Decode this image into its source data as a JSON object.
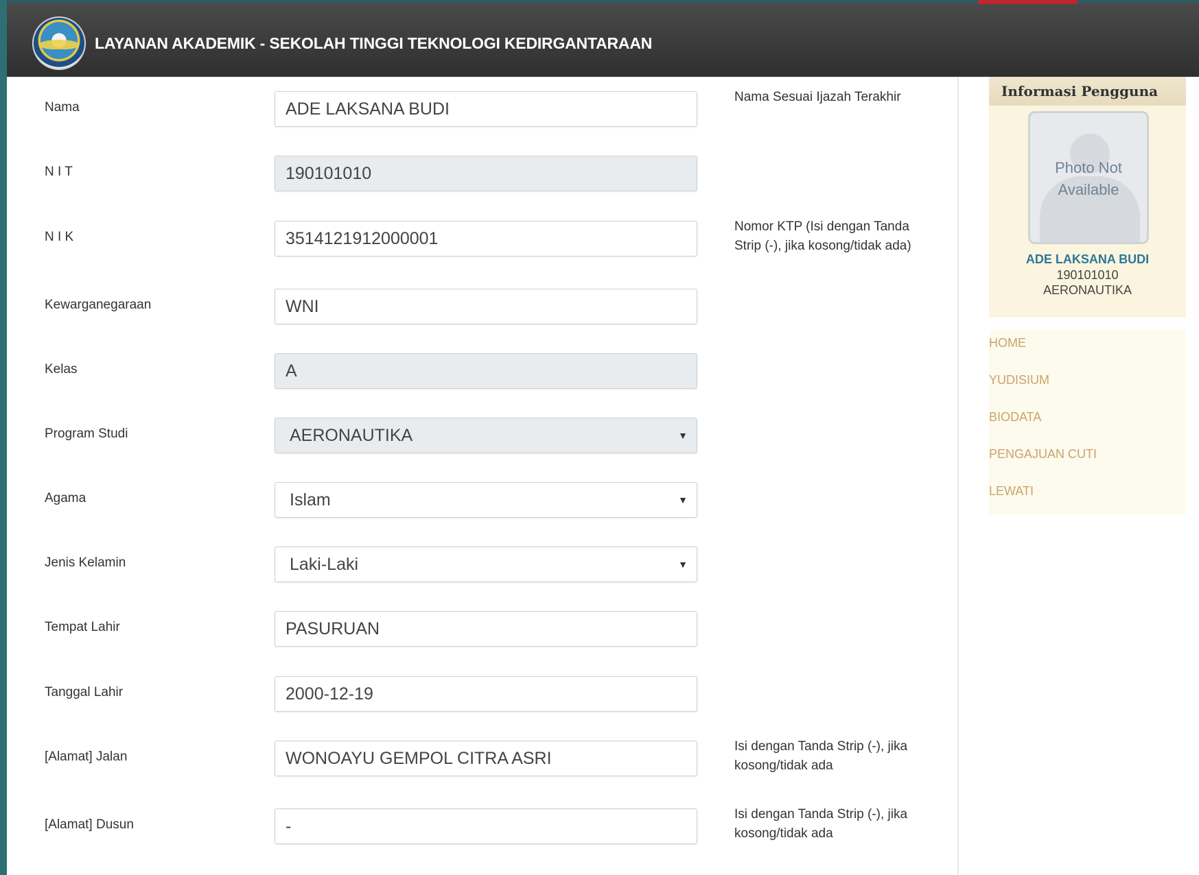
{
  "header": {
    "title": "LAYANAN AKADEMIK - SEKOLAH TINGGI TEKNOLOGI KEDIRGANTARAAN"
  },
  "form": {
    "nama": {
      "label": "Nama",
      "value": "ADE LAKSANA BUDI",
      "hint": "Nama Sesuai Ijazah Terakhir"
    },
    "nit": {
      "label": "N I T",
      "value": "190101010"
    },
    "nik": {
      "label": "N I K",
      "value": "3514121912000001",
      "hint": "Nomor KTP (Isi dengan Tanda Strip (-), jika kosong/tidak ada)"
    },
    "kewarganegaraan": {
      "label": "Kewarganegaraan",
      "value": "WNI"
    },
    "kelas": {
      "label": "Kelas",
      "value": "A"
    },
    "program_studi": {
      "label": "Program Studi",
      "value": "AERONAUTIKA"
    },
    "agama": {
      "label": "Agama",
      "value": "Islam"
    },
    "jenis_kelamin": {
      "label": "Jenis Kelamin",
      "value": "Laki-Laki"
    },
    "tempat_lahir": {
      "label": "Tempat Lahir",
      "value": "PASURUAN"
    },
    "tanggal_lahir": {
      "label": "Tanggal Lahir",
      "value": "2000-12-19"
    },
    "alamat_jalan": {
      "label": "[Alamat] Jalan",
      "value": "WONOAYU GEMPOL CITRA ASRI",
      "hint": "Isi dengan Tanda Strip (-), jika kosong/tidak ada"
    },
    "alamat_dusun": {
      "label": "[Alamat] Dusun",
      "value": "-",
      "hint": "Isi dengan Tanda Strip (-), jika kosong/tidak ada"
    }
  },
  "sidebar": {
    "title": "Informasi Pengguna",
    "photo_text_1": "Photo Not",
    "photo_text_2": "Available",
    "user_name": "ADE LAKSANA BUDI",
    "user_nit": "190101010",
    "user_prodi": "AERONAUTIKA",
    "menu": [
      {
        "label": "HOME"
      },
      {
        "label": "YUDISIUM"
      },
      {
        "label": "BIODATA"
      },
      {
        "label": "PENGAJUAN CUTI"
      },
      {
        "label": "LEWATI"
      }
    ]
  },
  "colors": {
    "header_bg": "#3a3a3a",
    "menu_link": "#c9a56a",
    "user_name": "#2e7799",
    "readonly_bg": "#e9ecef"
  }
}
